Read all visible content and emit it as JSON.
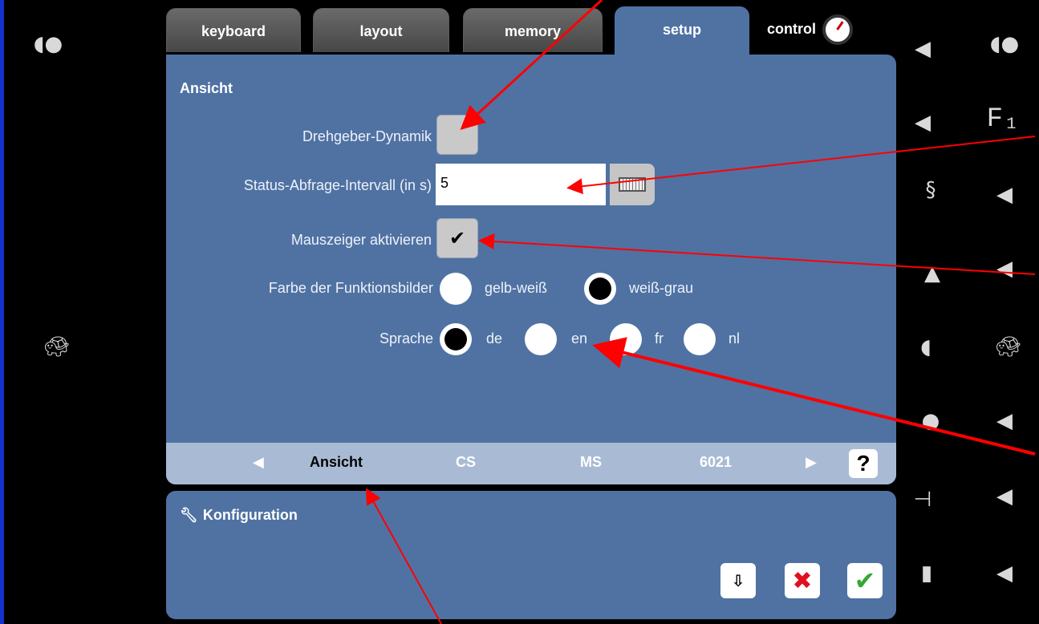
{
  "tabs": [
    {
      "label": "keyboard"
    },
    {
      "label": "layout"
    },
    {
      "label": "memory"
    },
    {
      "label": "setup"
    },
    {
      "label": "control"
    }
  ],
  "active_tab": "setup",
  "section": {
    "title": "Ansicht"
  },
  "settings": {
    "drehgeber_label": "Drehgeber-Dynamik",
    "drehgeber_checked": false,
    "status_label": "Status-Abfrage-Intervall (in s)",
    "status_value": "5",
    "mauszeiger_label": "Mauszeiger aktivieren",
    "mauszeiger_checked": true,
    "mauszeiger_check_glyph": "✔",
    "farbe_label": "Farbe der Funktionsbilder",
    "farbe_options": [
      "gelb-weiß",
      "weiß-grau"
    ],
    "farbe_selected": "weiß-grau",
    "sprache_label": "Sprache",
    "sprache_options": [
      "de",
      "en",
      "fr",
      "nl"
    ],
    "sprache_selected": "de"
  },
  "bottom_nav": {
    "items": [
      "Ansicht",
      "CS",
      "MS",
      "6021"
    ],
    "help_label": "?"
  },
  "config": {
    "title": "Konfiguration"
  },
  "left_icons": [
    "half-circle-icon",
    "turtle-icon"
  ],
  "right_icons_col1": [
    "speaker-icon",
    "speaker-icon",
    "hook-icon",
    "bell-icon",
    "half-circle-icon",
    "bell-icon",
    "horn-icon",
    "door-icon"
  ],
  "right_icons_col2": [
    "half-circle-icon",
    "f1-icon",
    "speaker-icon",
    "speaker-icon",
    "turtle-icon",
    "speaker-icon",
    "speaker-icon",
    "speaker-icon"
  ],
  "f1_text": "F₁",
  "colors": {
    "panel": "#4f72a3",
    "navbar": "#a9bbd4",
    "annotation_arrow": "#ff0000"
  }
}
